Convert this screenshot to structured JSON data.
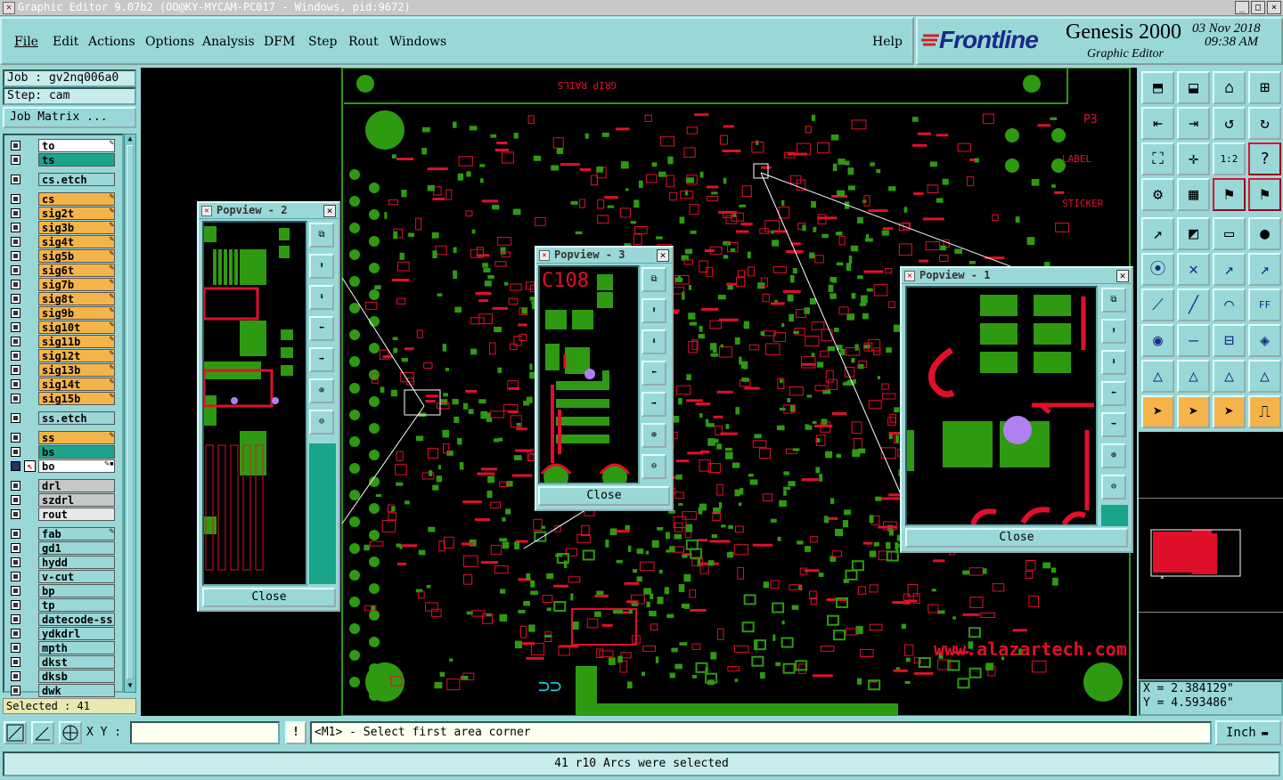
{
  "window": {
    "title": "Graphic Editor 9.07b2 (OO@KY-MYCAM-PC017 - Windows, pid:9672)",
    "controls": [
      "_",
      "□",
      "×"
    ]
  },
  "menu": {
    "items": [
      "File",
      "Edit",
      "Actions",
      "Options",
      "Analysis",
      "DFM",
      "Step",
      "Rout",
      "Windows"
    ],
    "help": "Help"
  },
  "brand": {
    "logo": "Frontline",
    "product": "Genesis 2000",
    "subtitle": "Graphic Editor",
    "date": "03 Nov 2018",
    "time": "09:38 AM"
  },
  "sidebar": {
    "job": "Job : gv2nq006a0",
    "step": "Step: cam",
    "job_matrix": "Job Matrix ...",
    "layers": [
      {
        "name": "to",
        "color": "#ffffff",
        "pen": true
      },
      {
        "name": "ts",
        "color": "#1aa58a",
        "pen": false
      },
      {
        "name": "cs.etch",
        "color": "#9ad8d8",
        "pen": false,
        "gap": true
      },
      {
        "name": "cs",
        "color": "#f5b44a",
        "pen": true,
        "gap": true
      },
      {
        "name": "sig2t",
        "color": "#f5b44a",
        "pen": true
      },
      {
        "name": "sig3b",
        "color": "#f5b44a",
        "pen": true
      },
      {
        "name": "sig4t",
        "color": "#f5b44a",
        "pen": true
      },
      {
        "name": "sig5b",
        "color": "#f5b44a",
        "pen": true
      },
      {
        "name": "sig6t",
        "color": "#f5b44a",
        "pen": true
      },
      {
        "name": "sig7b",
        "color": "#f5b44a",
        "pen": true
      },
      {
        "name": "sig8t",
        "color": "#f5b44a",
        "pen": true
      },
      {
        "name": "sig9b",
        "color": "#f5b44a",
        "pen": true
      },
      {
        "name": "sig10t",
        "color": "#f5b44a",
        "pen": true
      },
      {
        "name": "sig11b",
        "color": "#f5b44a",
        "pen": true
      },
      {
        "name": "sig12t",
        "color": "#f5b44a",
        "pen": true
      },
      {
        "name": "sig13b",
        "color": "#f5b44a",
        "pen": true
      },
      {
        "name": "sig14t",
        "color": "#f5b44a",
        "pen": true
      },
      {
        "name": "sig15b",
        "color": "#f5b44a",
        "pen": true
      },
      {
        "name": "ss.etch",
        "color": "#9ad8d8",
        "pen": false,
        "gap": true
      },
      {
        "name": "ss",
        "color": "#f5b44a",
        "pen": true,
        "gap": true
      },
      {
        "name": "bs",
        "color": "#1aa58a",
        "pen": false
      },
      {
        "name": "bo",
        "color": "#ffffff",
        "pen": true,
        "active": true
      },
      {
        "name": "drl",
        "color": "#c8c8c8",
        "pen": false,
        "gap": true
      },
      {
        "name": "szdrl",
        "color": "#c8c8c8",
        "pen": false
      },
      {
        "name": "rout",
        "color": "#e8e8e8",
        "pen": false
      },
      {
        "name": "fab",
        "color": "#9ad8d8",
        "pen": true,
        "gap": true
      },
      {
        "name": "gd1",
        "color": "#9ad8d8",
        "pen": false
      },
      {
        "name": "hydd",
        "color": "#9ad8d8",
        "pen": false
      },
      {
        "name": "v-cut",
        "color": "#9ad8d8",
        "pen": false
      },
      {
        "name": "bp",
        "color": "#9ad8d8",
        "pen": false
      },
      {
        "name": "tp",
        "color": "#9ad8d8",
        "pen": false
      },
      {
        "name": "datecode-ss",
        "color": "#9ad8d8",
        "pen": false
      },
      {
        "name": "ydkdrl",
        "color": "#9ad8d8",
        "pen": false
      },
      {
        "name": "mpth",
        "color": "#9ad8d8",
        "pen": false
      },
      {
        "name": "dkst",
        "color": "#9ad8d8",
        "pen": false
      },
      {
        "name": "dksb",
        "color": "#9ad8d8",
        "pen": false
      },
      {
        "name": "dwk",
        "color": "#9ad8d8",
        "pen": false
      }
    ],
    "selected": "Selected : 41"
  },
  "canvas": {
    "board_texts": [
      "GRIP RAILS",
      "www.alazartech.com",
      "LABEL",
      "STICKER",
      "P3"
    ]
  },
  "popups": {
    "p2": {
      "title": "Popview - 2",
      "close": "Close"
    },
    "p3": {
      "title": "Popview - 3",
      "close": "Close",
      "label": "C108"
    },
    "p1": {
      "title": "Popview - 1",
      "close": "Close"
    }
  },
  "coords": {
    "x": "X = 2.384129\"",
    "y": "Y = 4.593486\""
  },
  "bottom": {
    "xy_label": "X Y :",
    "xy_value": "",
    "prompt": "<M1> - Select first area corner",
    "units": "Inch",
    "status": "41 r10 Arcs were selected"
  },
  "colors": {
    "bg": "#9ad8d8",
    "copper": "#2e9a12",
    "silk": "#e0102a",
    "highlight": "#b080f0"
  }
}
